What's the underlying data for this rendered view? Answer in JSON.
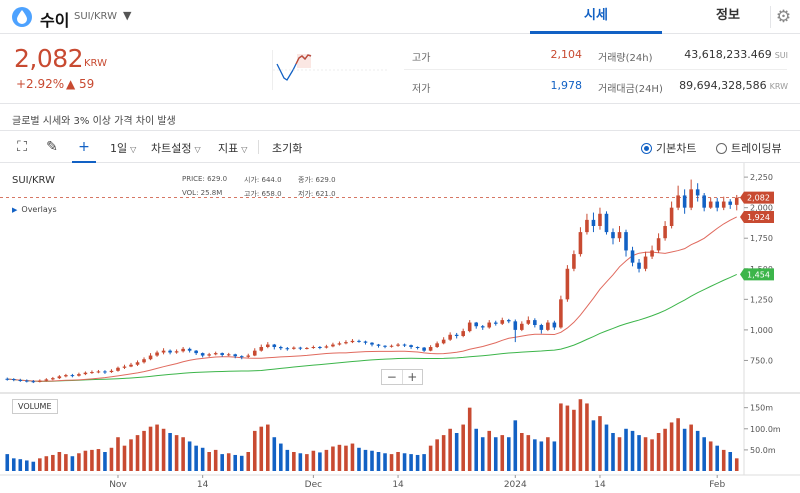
{
  "header": {
    "coin_name": "수이",
    "pair": "SUI/KRW",
    "tabs": {
      "price": "시세",
      "info": "정보"
    }
  },
  "summary": {
    "price": "2,082",
    "unit": "KRW",
    "change_rate": "+2.92%",
    "change_amount": "▲ 59",
    "high_label": "고가",
    "high_value": "2,104",
    "low_label": "저가",
    "low_value": "1,978",
    "volume_label": "거래량(24h)",
    "volume_value": "43,618,233.469",
    "volume_unit": "SUI",
    "amount_label": "거래대금(24H)",
    "amount_value": "89,694,328,586",
    "amount_unit": "KRW",
    "colors": {
      "up": "#c84a31",
      "down": "#1261c4"
    }
  },
  "notice": "글로벌 시세와 3% 이상 가격 차이 발생",
  "toolbar": {
    "interval": "1일",
    "chart_settings": "차트설정",
    "indicators": "지표",
    "reset": "초기화",
    "basic_chart": "기본차트",
    "trading_view": "트레이딩뷰"
  },
  "chart_panel": {
    "pair": "SUI/KRW",
    "overlays": "Overlays",
    "ohlc": {
      "price_label": "PRICE:",
      "price": "629.0",
      "open_label": "시가:",
      "open": "644.0",
      "close_label": "종가:",
      "close": "629.0",
      "vol_label": "VOL:",
      "vol": "25.8M",
      "high_label": "고가:",
      "high": "658.0",
      "low_label": "저가:",
      "low": "621.0"
    },
    "zoom_out": "−",
    "zoom_in": "+",
    "volume_label": "VOLUME"
  },
  "chart_data": {
    "type": "candlestick",
    "price_ticks": [
      750,
      1000,
      1250,
      1500,
      1750,
      2000,
      2250
    ],
    "price_tick_labels": [
      "750.0",
      "1,000",
      "1,250",
      "1,500",
      "1,750",
      "2,000",
      "2,250"
    ],
    "price_range": [
      500,
      2300
    ],
    "current_price": 2082,
    "current_price_label": "2,082",
    "ma_short_last": 1924,
    "ma_short_label": "1,924",
    "ma_long_last": 1454,
    "ma_long_label": "1,454",
    "volume_ticks": [
      50,
      100,
      150
    ],
    "volume_tick_labels": [
      "50.0m",
      "100.0m",
      "150m"
    ],
    "volume_range": [
      0,
      180
    ],
    "x_labels": [
      {
        "index": 17,
        "label": "Nov"
      },
      {
        "index": 30,
        "label": "14"
      },
      {
        "index": 47,
        "label": "Dec"
      },
      {
        "index": 60,
        "label": "14"
      },
      {
        "index": 78,
        "label": "2024"
      },
      {
        "index": 91,
        "label": "14"
      },
      {
        "index": 109,
        "label": "Feb"
      }
    ],
    "candles": [
      [
        600,
        598,
        610,
        585,
        40
      ],
      [
        598,
        590,
        605,
        580,
        30
      ],
      [
        590,
        585,
        600,
        575,
        28
      ],
      [
        585,
        580,
        595,
        570,
        25
      ],
      [
        580,
        575,
        590,
        565,
        22
      ],
      [
        575,
        585,
        595,
        570,
        30
      ],
      [
        585,
        595,
        605,
        578,
        35
      ],
      [
        595,
        605,
        615,
        588,
        38
      ],
      [
        605,
        620,
        630,
        598,
        45
      ],
      [
        620,
        630,
        640,
        612,
        40
      ],
      [
        630,
        625,
        640,
        612,
        35
      ],
      [
        625,
        638,
        650,
        618,
        42
      ],
      [
        638,
        650,
        660,
        630,
        48
      ],
      [
        650,
        655,
        668,
        640,
        50
      ],
      [
        655,
        660,
        672,
        645,
        52
      ],
      [
        660,
        655,
        670,
        640,
        45
      ],
      [
        655,
        665,
        678,
        648,
        55
      ],
      [
        665,
        690,
        700,
        658,
        80
      ],
      [
        690,
        700,
        715,
        680,
        60
      ],
      [
        700,
        715,
        730,
        695,
        75
      ],
      [
        715,
        735,
        750,
        705,
        85
      ],
      [
        735,
        760,
        775,
        725,
        95
      ],
      [
        760,
        790,
        810,
        752,
        105
      ],
      [
        790,
        815,
        830,
        780,
        110
      ],
      [
        815,
        830,
        850,
        800,
        100
      ],
      [
        830,
        815,
        840,
        800,
        90
      ],
      [
        815,
        825,
        840,
        805,
        85
      ],
      [
        825,
        845,
        860,
        815,
        80
      ],
      [
        845,
        830,
        855,
        815,
        70
      ],
      [
        830,
        810,
        835,
        795,
        60
      ],
      [
        810,
        790,
        815,
        775,
        55
      ],
      [
        790,
        800,
        812,
        780,
        45
      ],
      [
        800,
        810,
        822,
        792,
        50
      ],
      [
        810,
        795,
        815,
        780,
        40
      ],
      [
        795,
        800,
        812,
        785,
        42
      ],
      [
        800,
        785,
        805,
        768,
        38
      ],
      [
        785,
        780,
        792,
        760,
        36
      ],
      [
        780,
        790,
        805,
        770,
        45
      ],
      [
        790,
        830,
        850,
        785,
        95
      ],
      [
        830,
        860,
        880,
        822,
        105
      ],
      [
        860,
        880,
        900,
        850,
        110
      ],
      [
        880,
        860,
        885,
        840,
        80
      ],
      [
        860,
        850,
        870,
        835,
        65
      ],
      [
        850,
        845,
        860,
        830,
        50
      ],
      [
        845,
        855,
        865,
        838,
        45
      ],
      [
        855,
        848,
        862,
        835,
        42
      ],
      [
        848,
        852,
        860,
        840,
        40
      ],
      [
        852,
        860,
        872,
        845,
        48
      ],
      [
        860,
        855,
        868,
        842,
        44
      ],
      [
        855,
        865,
        878,
        848,
        50
      ],
      [
        865,
        880,
        895,
        858,
        58
      ],
      [
        880,
        890,
        905,
        872,
        62
      ],
      [
        890,
        900,
        915,
        882,
        60
      ],
      [
        900,
        910,
        925,
        892,
        65
      ],
      [
        910,
        905,
        920,
        895,
        55
      ],
      [
        905,
        895,
        912,
        880,
        50
      ],
      [
        895,
        880,
        900,
        865,
        48
      ],
      [
        880,
        870,
        885,
        855,
        45
      ],
      [
        870,
        865,
        875,
        850,
        42
      ],
      [
        865,
        870,
        880,
        855,
        40
      ],
      [
        870,
        880,
        892,
        862,
        45
      ],
      [
        880,
        875,
        888,
        860,
        42
      ],
      [
        875,
        860,
        880,
        845,
        40
      ],
      [
        860,
        855,
        865,
        840,
        38
      ],
      [
        855,
        830,
        860,
        820,
        40
      ],
      [
        830,
        860,
        875,
        825,
        60
      ],
      [
        860,
        890,
        905,
        852,
        75
      ],
      [
        890,
        920,
        940,
        882,
        85
      ],
      [
        920,
        960,
        980,
        910,
        100
      ],
      [
        960,
        950,
        975,
        930,
        90
      ],
      [
        950,
        990,
        1010,
        940,
        110
      ],
      [
        990,
        1060,
        1080,
        980,
        150
      ],
      [
        1060,
        1030,
        1065,
        1010,
        100
      ],
      [
        1030,
        1020,
        1040,
        1000,
        80
      ],
      [
        1020,
        1060,
        1080,
        1010,
        95
      ],
      [
        1060,
        1050,
        1075,
        1035,
        80
      ],
      [
        1050,
        1080,
        1100,
        1040,
        85
      ],
      [
        1080,
        1070,
        1090,
        1055,
        80
      ],
      [
        1070,
        1000,
        1085,
        900,
        120
      ],
      [
        1000,
        1050,
        1070,
        990,
        90
      ],
      [
        1050,
        1080,
        1110,
        1040,
        85
      ],
      [
        1080,
        1040,
        1095,
        1020,
        75
      ],
      [
        1040,
        1000,
        1050,
        970,
        70
      ],
      [
        1000,
        1060,
        1080,
        990,
        80
      ],
      [
        1060,
        1020,
        1075,
        1000,
        70
      ],
      [
        1020,
        1250,
        1280,
        1010,
        160
      ],
      [
        1250,
        1500,
        1530,
        1230,
        155
      ],
      [
        1500,
        1620,
        1650,
        1480,
        145
      ],
      [
        1620,
        1800,
        1840,
        1600,
        170
      ],
      [
        1800,
        1900,
        1950,
        1780,
        160
      ],
      [
        1900,
        1850,
        1960,
        1800,
        120
      ],
      [
        1850,
        1950,
        2000,
        1820,
        130
      ],
      [
        1950,
        1800,
        1970,
        1780,
        110
      ],
      [
        1800,
        1750,
        1830,
        1700,
        90
      ],
      [
        1750,
        1800,
        1850,
        1720,
        80
      ],
      [
        1800,
        1650,
        1820,
        1600,
        100
      ],
      [
        1650,
        1550,
        1680,
        1520,
        95
      ],
      [
        1550,
        1500,
        1580,
        1470,
        85
      ],
      [
        1500,
        1600,
        1640,
        1480,
        80
      ],
      [
        1600,
        1650,
        1690,
        1580,
        75
      ],
      [
        1650,
        1750,
        1790,
        1630,
        90
      ],
      [
        1750,
        1850,
        1890,
        1730,
        100
      ],
      [
        1850,
        2000,
        2050,
        1830,
        115
      ],
      [
        2000,
        2100,
        2180,
        1980,
        125
      ],
      [
        2100,
        2000,
        2150,
        1950,
        100
      ],
      [
        2000,
        2150,
        2230,
        1980,
        110
      ],
      [
        2150,
        2100,
        2200,
        2050,
        95
      ],
      [
        2100,
        2000,
        2120,
        1970,
        80
      ],
      [
        2000,
        2050,
        2080,
        1990,
        70
      ],
      [
        2050,
        2000,
        2080,
        1970,
        60
      ],
      [
        2000,
        2050,
        2090,
        1980,
        50
      ],
      [
        2050,
        2023,
        2070,
        1990,
        45
      ],
      [
        2023,
        2082,
        2104,
        1978,
        30
      ]
    ]
  }
}
